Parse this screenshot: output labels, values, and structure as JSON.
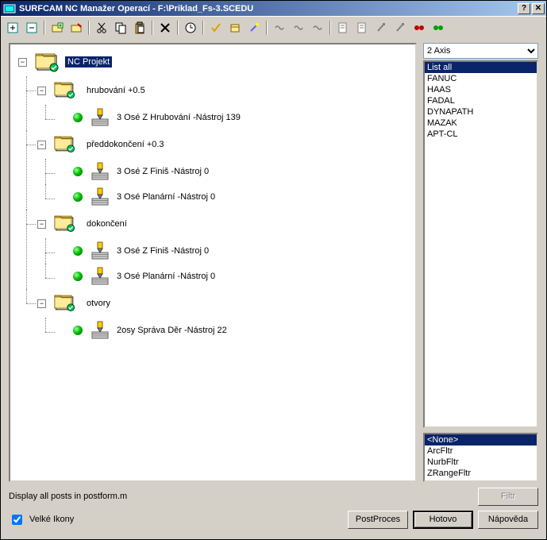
{
  "title": "SURFCAM NC Manažer Operací - F:\\Priklad_Fs-3.SCEDU",
  "toolbar_icons": [
    "expand-plus-icon",
    "collapse-minus-icon",
    "sep",
    "folder-plus-icon",
    "folder-edit-icon",
    "sep",
    "cut-icon",
    "copy-icon",
    "paste-icon",
    "sep",
    "delete-icon",
    "sep",
    "clock-icon",
    "sep",
    "check-icon",
    "box-icon",
    "wand-icon",
    "sep",
    "link1-icon",
    "link2-icon",
    "link3-icon",
    "sep",
    "doc1-icon",
    "doc2-icon",
    "brush-icon",
    "brush2-icon",
    "red-dot-icon",
    "green-dot-icon"
  ],
  "tree": {
    "root": {
      "label": "NC Projekt",
      "selected": true,
      "children": [
        {
          "label": "hrubování +0.5",
          "ops": [
            {
              "label": "3 Osé Z Hrubování  -Nástroj 139"
            }
          ]
        },
        {
          "label": "předdokončení +0.3",
          "ops": [
            {
              "label": "3 Osé Z Finiš  -Nástroj 0"
            },
            {
              "label": "3 Osé Planární  -Nástroj 0"
            }
          ]
        },
        {
          "label": "dokončení",
          "ops": [
            {
              "label": "3 Osé Z Finiš  -Nástroj 0"
            },
            {
              "label": "3 Osé Planární  -Nástroj 0"
            }
          ]
        },
        {
          "label": "otvory",
          "ops": [
            {
              "label": "2osy Správa Děr  -Nástroj 22"
            }
          ]
        }
      ]
    }
  },
  "axis_select": "2 Axis",
  "post_list": [
    "List all",
    "FANUC",
    "HAAS",
    "FADAL",
    "DYNAPATH",
    "MAZAK",
    "APT-CL"
  ],
  "post_selected": "List all",
  "filter_list": [
    "<None>",
    "ArcFltr",
    "NurbFltr",
    "ZRangeFltr"
  ],
  "filter_selected": "<None>",
  "status_text": "Display all posts in postform.m",
  "filter_btn": "Filtr",
  "checkbox_label": "Velké Ikony",
  "checkbox_checked": true,
  "buttons": {
    "post": "PostProces",
    "done": "Hotovo",
    "help": "Nápověda"
  }
}
